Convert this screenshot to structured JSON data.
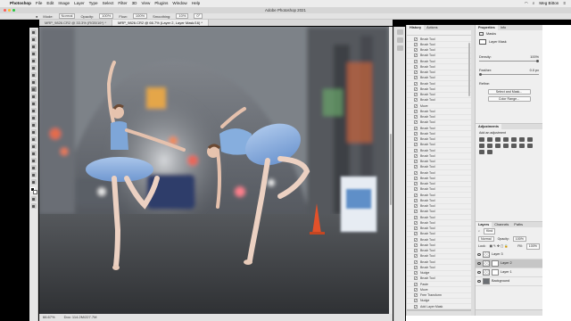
{
  "menubar": {
    "apple": "",
    "items": [
      "Photoshop",
      "File",
      "Edit",
      "Image",
      "Layer",
      "Type",
      "Select",
      "Filter",
      "3D",
      "View",
      "Plugins",
      "Window",
      "Help"
    ],
    "user": "Meg Bitton",
    "clock": ""
  },
  "window": {
    "title": "Adobe Photoshop 2021"
  },
  "options": {
    "mode_label": "Mode:",
    "mode_value": "Normal",
    "opacity_label": "Opacity:",
    "opacity_value": "100%",
    "flow_label": "Flow:",
    "flow_value": "100%",
    "smoothing_label": "Smoothing:",
    "smoothing_value": "10%",
    "angle_value": "0°"
  },
  "doc_tabs": [
    {
      "label": "MRP_9826.CR2 @ 33.3% (RGB/16*) *"
    },
    {
      "label": "MRP_9826.CR2 @ 66.7% (Layer 2, Layer Mask/16) *"
    }
  ],
  "status": {
    "zoom": "66.67%",
    "doc": "Doc: 114.2M/227.7M"
  },
  "history": {
    "tabs": [
      "History",
      "Actions"
    ],
    "items": [
      "Brush Tool",
      "Brush Tool",
      "Brush Tool",
      "Brush Tool",
      "Brush Tool",
      "Brush Tool",
      "Brush Tool",
      "Brush Tool",
      "Brush Tool",
      "Brush Tool",
      "Brush Tool",
      "Brush Tool",
      "Move",
      "Brush Tool",
      "Brush Tool",
      "Brush Tool",
      "Brush Tool",
      "Brush Tool",
      "Brush Tool",
      "Brush Tool",
      "Brush Tool",
      "Brush Tool",
      "Brush Tool",
      "Brush Tool",
      "Brush Tool",
      "Brush Tool",
      "Brush Tool",
      "Brush Tool",
      "Brush Tool",
      "Brush Tool",
      "Brush Tool",
      "Brush Tool",
      "Brush Tool",
      "Brush Tool",
      "Brush Tool",
      "Brush Tool",
      "Brush Tool",
      "Brush Tool",
      "Brush Tool",
      "Brush Tool",
      "Brush Tool",
      "Brush Tool",
      "Nudge",
      "Brush Tool",
      "Paste",
      "Move",
      "Free Transform",
      "Nudge",
      "Add Layer Mask",
      "Brush Tool"
    ],
    "active_index": 49
  },
  "properties": {
    "tabs": [
      "Properties",
      "Info"
    ],
    "masks_label": "Masks",
    "layer_mask_label": "Layer Mask",
    "density_label": "Density:",
    "density_value": "100%",
    "feather_label": "Feather:",
    "feather_value": "0.0 px",
    "refine_label": "Refine:",
    "select_mask_button": "Select and Mask...",
    "color_range_button": "Color Range..."
  },
  "adjustments": {
    "tabs": [
      "Adjustments"
    ],
    "hint": "Add an adjustment"
  },
  "layers": {
    "tabs": [
      "Layers",
      "Channels",
      "Paths"
    ],
    "kind_label": "Kind",
    "blend_mode": "Normal",
    "opacity_label": "Opacity:",
    "opacity_value": "100%",
    "lock_label": "Lock:",
    "fill_label": "Fill:",
    "fill_value": "100%",
    "items": [
      {
        "name": "Layer 3",
        "active": false
      },
      {
        "name": "Layer 2",
        "active": true
      },
      {
        "name": "Layer 1",
        "active": false
      },
      {
        "name": "Background",
        "active": false
      }
    ]
  },
  "colors": {
    "accent": "#1473e6",
    "panel": "#efefef",
    "tutu": "#8fb3e0"
  }
}
